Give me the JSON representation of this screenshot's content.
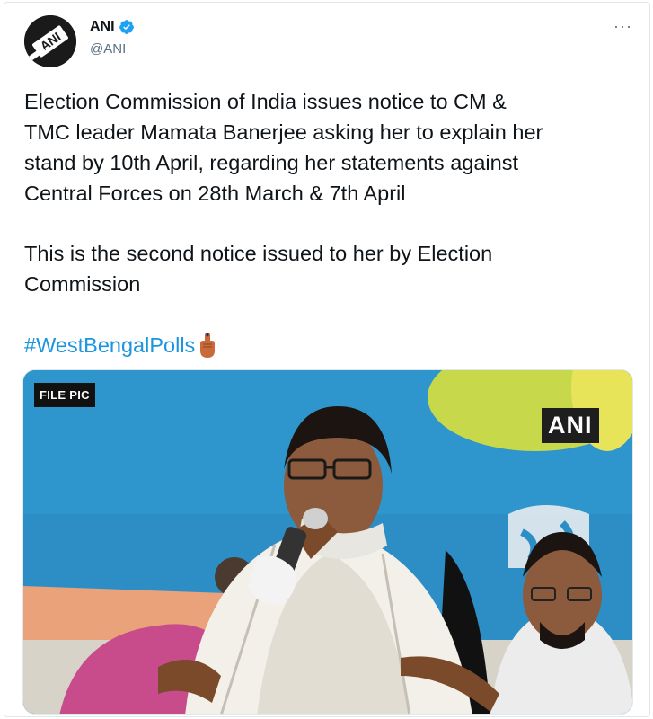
{
  "tweet": {
    "author_name": "ANI",
    "author_handle": "@ANI",
    "avatar_text": "ANI",
    "more_icon": "···",
    "paragraph1": [
      "Election Commission of India issues notice to CM &",
      "TMC leader Mamata Banerjee asking her to explain her",
      "stand by 10th April, regarding her statements against",
      "Central Forces on 28th March & 7th April"
    ],
    "paragraph2": [
      "This is the second notice issued to her by Election",
      "Commission"
    ],
    "hashtag": "#WestBengalPolls",
    "hashtag_emoji": "inked-finger-emoji",
    "media": {
      "file_pic_label": "FILE PIC",
      "watermark": "ANI"
    }
  },
  "colors": {
    "hashtag": "#1b95e0",
    "verified": "#1da1f2",
    "handle": "#5b7083",
    "text": "#0f1419"
  }
}
